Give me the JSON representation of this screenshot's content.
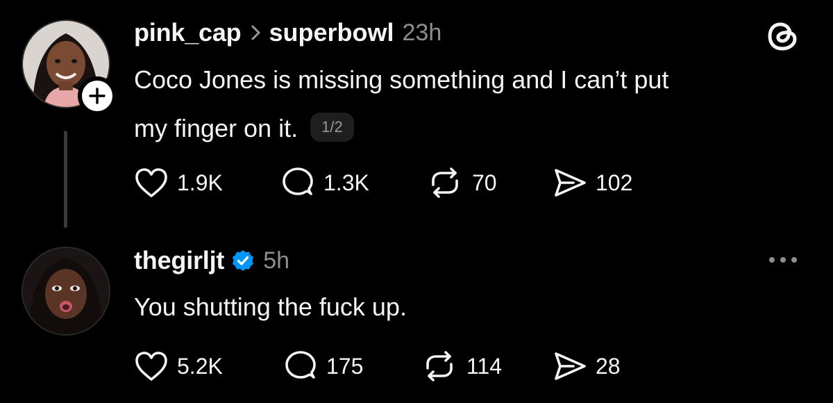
{
  "posts": [
    {
      "author": "pink_cap",
      "topic": "superbowl",
      "time": "23h",
      "text_line1": "Coco Jones is missing something and I can’t put",
      "text_line2": "my finger on it.",
      "page_indicator": "1/2",
      "likes": "1.9K",
      "replies": "1.3K",
      "reposts": "70",
      "shares": "102"
    },
    {
      "author": "thegirljt",
      "verified": true,
      "time": "5h",
      "text": "You shutting the fuck up.",
      "likes": "5.2K",
      "replies": "175",
      "reposts": "114",
      "shares": "28"
    }
  ],
  "colors": {
    "background": "#000000",
    "text": "#f3f5f7",
    "muted": "#8e8e8e",
    "verified": "#0095f6",
    "thread_line": "#3a3a3a"
  },
  "icons": [
    "plus-icon",
    "chevron-right-icon",
    "threads-logo-icon",
    "verified-badge-icon",
    "more-icon",
    "heart-icon",
    "comment-icon",
    "repost-icon",
    "share-icon"
  ]
}
